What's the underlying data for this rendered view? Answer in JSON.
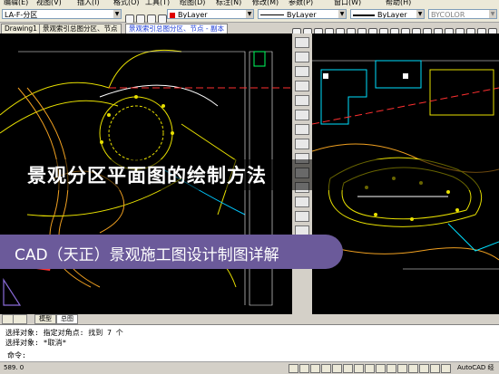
{
  "menu": [
    "编辑(E)",
    "视图(V)",
    "插入(I)",
    "格式(O)",
    "工具(T)",
    "绘图(D)",
    "标注(N)",
    "修改(M)",
    "参数(P)",
    "窗口(W)",
    "帮助(H)"
  ],
  "toolbar": {
    "layer": "LA-F-分区",
    "color": "ByLayer",
    "linetype": "ByLayer",
    "lineweight": "ByLayer",
    "plotstyle": "BYCOLOR"
  },
  "tabs": [
    "Drawing1",
    "景观索引总图分区、节点",
    "景观索引总图分区、节点 - 副本"
  ],
  "layout_tabs": [
    "模型",
    "总图"
  ],
  "command": {
    "line1": "选择对象: 指定对角点: 找到 7 个",
    "line2": "选择对象: *取消*",
    "prompt": "命令:"
  },
  "status": {
    "coords": "589. 0",
    "app": "AutoCAD 经"
  },
  "overlay": {
    "title": "景观分区平面图的绘制方法",
    "subtitle": "CAD（天正）景观施工图设计制图详解"
  },
  "colors": {
    "banner": "#6b5a9a",
    "cad_background": "#000000",
    "active_tab": "#1a3ad6"
  }
}
